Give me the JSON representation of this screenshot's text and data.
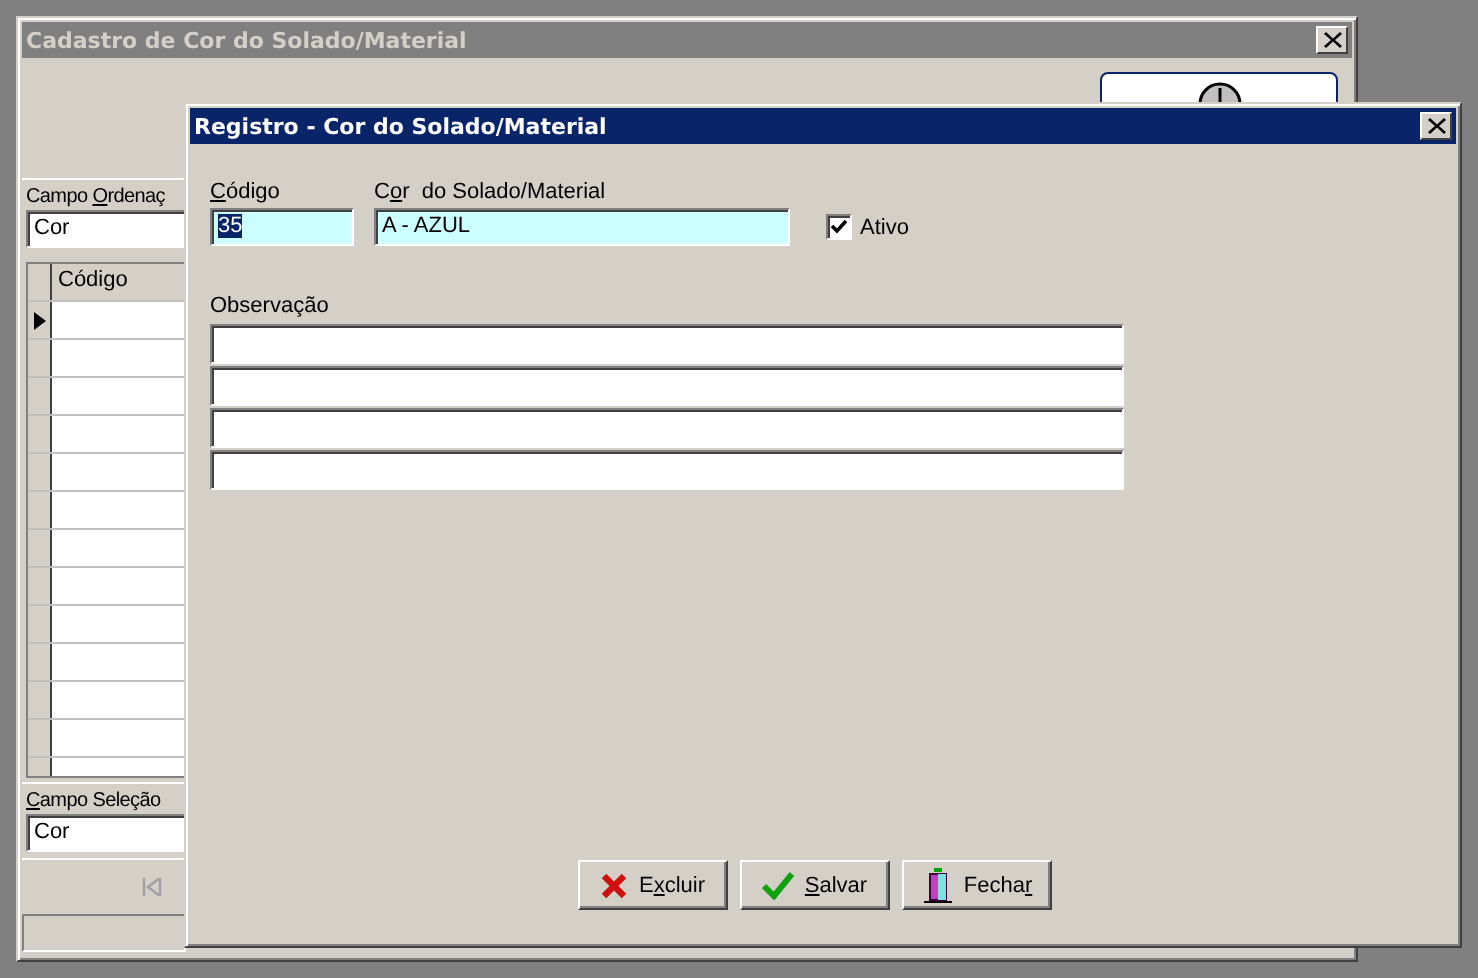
{
  "background_window": {
    "title": "Cadastro de Cor do Solado/Material",
    "order_field": {
      "label": {
        "before": "Campo ",
        "key": "O",
        "after": "rdenaç"
      },
      "value": "Cor"
    },
    "grid": {
      "columns": [
        "Código"
      ]
    },
    "selection_field": {
      "label": {
        "key": "C",
        "after": "ampo Seleção"
      },
      "value": "Cor"
    }
  },
  "dialog": {
    "title": "Registro - Cor do Solado/Material",
    "code": {
      "label": {
        "key": "C",
        "after": "ódigo"
      },
      "value": "35",
      "text_selected": true
    },
    "color": {
      "label": {
        "before": "C",
        "key": "o",
        "after": "r  do Solado/Material"
      },
      "value": "A - AZUL",
      "text_selected": false
    },
    "active": {
      "label": "Ativo",
      "checked": true
    },
    "observation": {
      "label": "Observação"
    },
    "buttons": [
      {
        "kind": "delete",
        "label": {
          "before": "E",
          "key": "x",
          "after": "cluir"
        }
      },
      {
        "kind": "save",
        "label": {
          "key": "S",
          "after": "alvar"
        }
      },
      {
        "kind": "close",
        "label": {
          "before": "Fecha",
          "key": "r"
        }
      }
    ]
  }
}
